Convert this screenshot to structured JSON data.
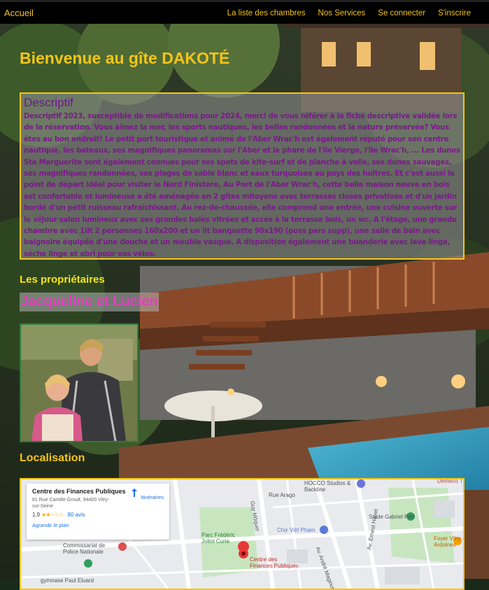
{
  "navbar": {
    "brand": "Accueil",
    "links": [
      "La liste des chambres",
      "Nos Services",
      "Se connecter",
      "S'inscrire"
    ]
  },
  "welcome_title": "Bienvenue au gîte DAKOTÉ",
  "descriptif": {
    "title": "Descriptif",
    "text": "Descriptif 2023, susceptible de modifications pour 2024, merci de vous référer à la fiche descriptive validée lors de la réservation. Vous aimez la mer, les sports nautiques, les belles randonnées et la nature préservée? Vous êtes au bon endroit! Le petit port touristique et animé de l'Aber Wrac'h est également réputé pour son centre nautique, les bateaux, ses magnifiques panoramas sur l'Aber et le phare de l'île Vierge, l'île Wrac'h, ... Les dunes Ste Marguerite sont également connues pour ses spots de kite-surf et de planche à voile, ses dunes sauvages, ses magnifiques randonnées, ses plages de sable blanc et eaux turquoises au pays des huîtres. Et c'est aussi le point de départ idéal pour visiter le Nord Finistère, Au Port de l'Aber Wrac'h, cette belle maison neuve en bois est confortable et lumineuse a été aménagée en 2 gîtes mitoyens avec terrasses closes privatives et d'un jardin bordé d'un petit ruisseau rafraîchissant. Au rez-de-chaussée, elle comprend une entrée, une cuisine ouverte sur le séjour salon lumineux avec ses grandes baies vitrées et accès à la terrasse bois, un wc. A l'étage, une grande chambre avec 1lit 2 personnes 160x200 et un lit banquette 90x190 (poss pers supp), une salle de bain avec baignoire équipée d'une douche et un meuble vasque. A disposition également une buanderie avec lave linge, sèche linge et abri pour vos vélos."
  },
  "owners": {
    "title": "Les propriétaires",
    "names": "Jacqueline et Lucien"
  },
  "localisation": {
    "title": "Localisation",
    "place_name": "Centre des Finances Publiques",
    "address": "81 Rue Camille Groult, 94400 Vitry-sur-Seine",
    "rating": "1,9",
    "stars": "★★☆☆☆",
    "reviews": "80 avis",
    "enlarge": "Agrandir le plan",
    "directions": "Itinéraires",
    "map_labels": {
      "arago": "Rue Arago",
      "hocco": "HOCCO Studios & Backline",
      "stade": "Stade Gabriel Péri",
      "foyer": "Foyer Vitry - Les Ardoines",
      "parc": "Parc Frédéric Joliot Curie",
      "cho": "Chợ Việt Phạm",
      "commissariat": "Commissariat de Police Nationale",
      "gymnase": "gymnase Paul Eluard",
      "pin": "Centre des Finances Publiques",
      "guy": "Guy Môquet",
      "ernest": "Av. Ernest Havet",
      "andre": "Av. André Maginot",
      "demeco": "Demeco TELLOT"
    }
  },
  "colors": {
    "accent": "#f5c518",
    "descriptif_text": "#7a1a8a",
    "owners_names": "#e040c0",
    "photo_border": "#2c7a3a"
  }
}
